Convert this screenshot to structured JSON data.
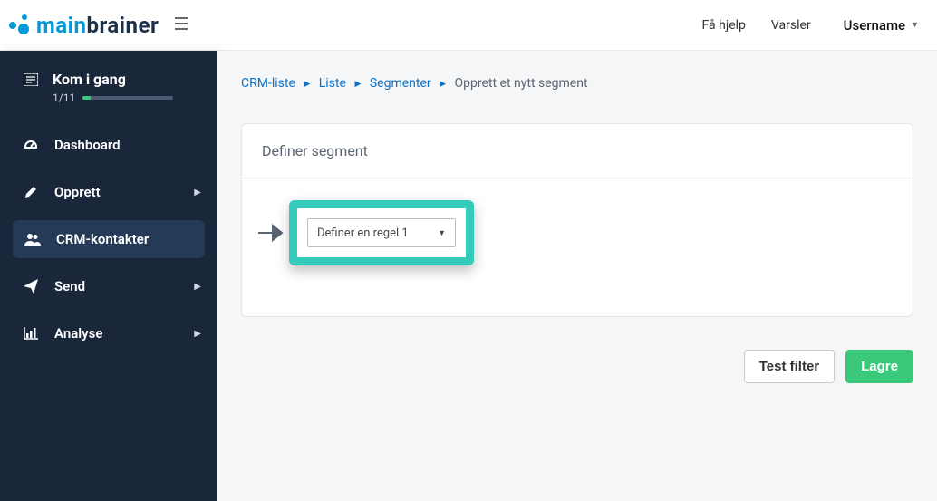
{
  "topbar": {
    "logo_main": "main",
    "logo_sub": "brainer",
    "help": "Få hjelp",
    "alerts": "Varsler",
    "username": "Username"
  },
  "sidebar": {
    "start": {
      "title": "Kom i gang",
      "progress": "1/11"
    },
    "items": [
      {
        "label": "Dashboard",
        "expandable": false
      },
      {
        "label": "Opprett",
        "expandable": true
      },
      {
        "label": "CRM-kontakter",
        "expandable": false,
        "active": true
      },
      {
        "label": "Send",
        "expandable": true
      },
      {
        "label": "Analyse",
        "expandable": true
      }
    ]
  },
  "breadcrumb": {
    "items": [
      "CRM-liste",
      "Liste",
      "Segmenter"
    ],
    "current": "Opprett et nytt segment"
  },
  "card": {
    "title": "Definer segment",
    "rule_select": "Definer en regel 1"
  },
  "actions": {
    "test": "Test filter",
    "save": "Lagre"
  },
  "colors": {
    "brand": "#0399d7",
    "sidebar": "#1a263a",
    "highlight": "#35cbba",
    "success": "#3ac97b"
  }
}
